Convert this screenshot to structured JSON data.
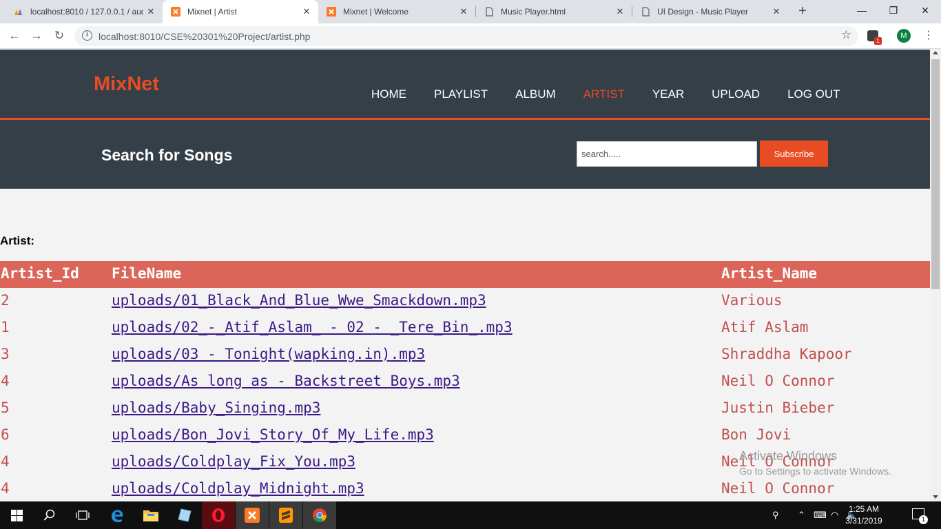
{
  "browser": {
    "tabs": [
      {
        "title": "localhost:8010 / 127.0.0.1 / aud",
        "icon": "phpmyadmin-icon",
        "active": false
      },
      {
        "title": "Mixnet | Artist",
        "icon": "xampp-icon",
        "active": true
      },
      {
        "title": "Mixnet | Welcome",
        "icon": "xampp-icon",
        "active": false
      },
      {
        "title": "Music Player.html",
        "icon": "document-icon",
        "active": false
      },
      {
        "title": "UI Design - Music Player",
        "icon": "document-icon",
        "active": false
      }
    ],
    "url": "localhost:8010/CSE%20301%20Project/artist.php",
    "profile_initial": "M",
    "extension_badge": "1"
  },
  "site": {
    "logo": "MixNet",
    "nav": [
      "HOME",
      "PLAYLIST",
      "ALBUM",
      "ARTIST",
      "YEAR",
      "UPLOAD",
      "LOG OUT"
    ],
    "active_nav": "ARTIST",
    "search_title": "Search for Songs",
    "search_placeholder": "search.....",
    "subscribe_label": "Subscribe",
    "section_label": "Artist:",
    "accent_color": "#e84c23",
    "header_color": "#343f48",
    "table_header_color": "#dc6559"
  },
  "table": {
    "headers": [
      "Artist_Id",
      "FileName",
      "Artist_Name"
    ],
    "rows": [
      {
        "id": "2",
        "file": "uploads/01_Black_And_Blue_Wwe_Smackdown.mp3",
        "artist": "Various"
      },
      {
        "id": "1",
        "file": "uploads/02_-_Atif_Aslam_ - 02 - _Tere_Bin_.mp3",
        "artist": "Atif Aslam"
      },
      {
        "id": "3",
        "file": "uploads/03 - Tonight(wapking.in).mp3",
        "artist": "Shraddha Kapoor"
      },
      {
        "id": "4",
        "file": "uploads/As long as - Backstreet Boys.mp3",
        "artist": "Neil O Connor"
      },
      {
        "id": "5",
        "file": "uploads/Baby_Singing.mp3",
        "artist": "Justin Bieber"
      },
      {
        "id": "6",
        "file": "uploads/Bon_Jovi_Story_Of_My_Life.mp3",
        "artist": "Bon Jovi"
      },
      {
        "id": "4",
        "file": "uploads/Coldplay_Fix_You.mp3",
        "artist": "Neil O Connor"
      },
      {
        "id": "4",
        "file": "uploads/Coldplay_Midnight.mp3",
        "artist": "Neil O Connor"
      }
    ]
  },
  "watermark": {
    "line1": "Activate Windows",
    "line2": "Go to Settings to activate Windows."
  },
  "taskbar": {
    "apps": [
      "windows-start-icon",
      "search-icon",
      "task-view-icon",
      "edge-icon",
      "file-explorer-icon",
      "notepad-icon",
      "opera-icon",
      "xampp-icon",
      "sublime-text-icon",
      "chrome-icon"
    ],
    "time": "1:25 AM",
    "date": "3/31/2019",
    "notification_count": "1"
  }
}
